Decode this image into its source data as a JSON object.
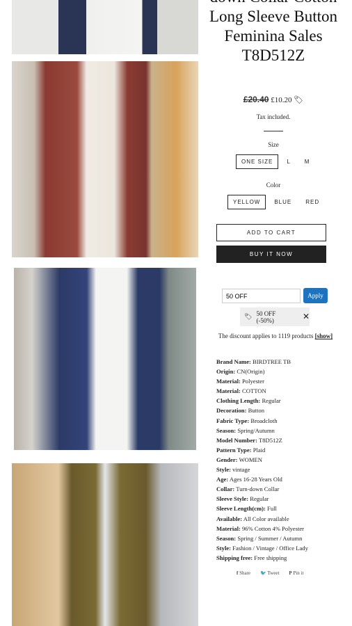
{
  "product": {
    "title": "down Collar Cotton Long Sleeve Button Feminina Sales T8D512Z",
    "old_price": "£20.40",
    "price": "£10.20",
    "tax": "Tax included."
  },
  "size": {
    "label": "Size",
    "options": [
      "ONE SIZE",
      "L",
      "M"
    ],
    "selected": "ONE SIZE"
  },
  "color": {
    "label": "Color",
    "options": [
      "YELLOW",
      "BLUE",
      "RED"
    ],
    "selected": "YELLOW"
  },
  "buttons": {
    "add_to_cart": "ADD TO CART",
    "buy_now": "BUY IT NOW"
  },
  "discount": {
    "code_value": "50 OFF",
    "apply": "Apply",
    "chip": "50 OFF (-50%)",
    "applies_text": "The discount applies to 1119 products",
    "show": "[show]"
  },
  "specs": [
    [
      "Brand Name:",
      "BIRDTREE TB"
    ],
    [
      "Origin:",
      "CN(Origin)"
    ],
    [
      "Material:",
      "Polyester"
    ],
    [
      "Material:",
      "COTTON"
    ],
    [
      "Clothing Length:",
      "Regular"
    ],
    [
      "Decoration:",
      "Button"
    ],
    [
      "Fabric Type:",
      "Broadcloth"
    ],
    [
      "Season:",
      "Spring/Autumn"
    ],
    [
      "Model Number:",
      "T8D512Z"
    ],
    [
      "Pattern Type:",
      "Plaid"
    ],
    [
      "Gender:",
      "WOMEN"
    ],
    [
      "Style:",
      "vintage"
    ],
    [
      "Age:",
      "Ages 16-28 Years Old"
    ],
    [
      "Collar:",
      "Turn-down Collar"
    ],
    [
      "Sleeve Style:",
      "Regular"
    ],
    [
      "Sleeve Length(cm):",
      "Full"
    ],
    [
      "Available:",
      "All Color available"
    ],
    [
      "Material:",
      "96% Cotton 4% Polyester"
    ],
    [
      "Season:",
      "Spring / Summer / Autumn"
    ],
    [
      "Style:",
      "Fashion / Vintage / Office Lady"
    ],
    [
      "Shipping free:",
      "Free shipping"
    ]
  ],
  "share": {
    "facebook": "Share",
    "twitter": "Tweet",
    "pinterest": "Pin it"
  },
  "colors": {
    "apply": "#1e73be",
    "buy": "#222222"
  }
}
